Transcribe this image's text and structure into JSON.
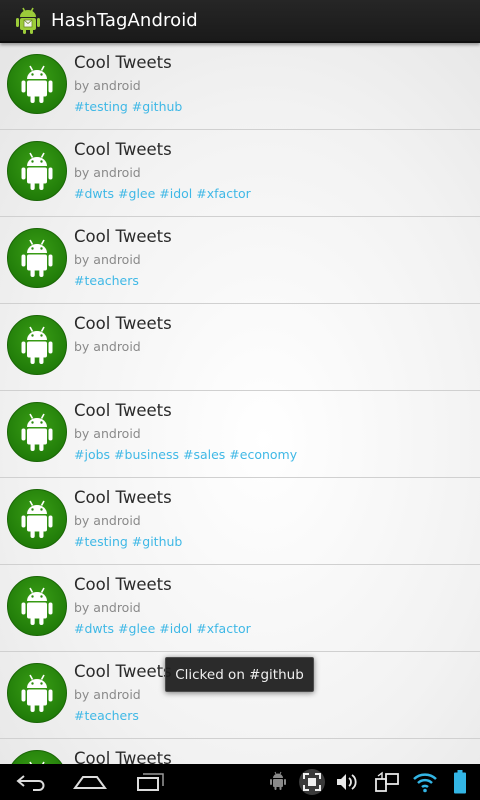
{
  "app": {
    "title": "HashTagAndroid",
    "icon": "android-app-icon"
  },
  "tweets": [
    {
      "title": "Cool Tweets",
      "author": "by android",
      "tags": [
        "#testing",
        "#github"
      ]
    },
    {
      "title": "Cool Tweets",
      "author": "by android",
      "tags": [
        "#dwts",
        "#glee",
        "#idol",
        "#xfactor"
      ]
    },
    {
      "title": "Cool Tweets",
      "author": "by android",
      "tags": [
        "#teachers"
      ]
    },
    {
      "title": "Cool Tweets",
      "author": "by android",
      "tags": []
    },
    {
      "title": "Cool Tweets",
      "author": "by android",
      "tags": [
        "#jobs",
        "#business",
        "#sales",
        "#economy"
      ]
    },
    {
      "title": "Cool Tweets",
      "author": "by android",
      "tags": [
        "#testing",
        "#github"
      ]
    },
    {
      "title": "Cool Tweets",
      "author": "by android",
      "tags": [
        "#dwts",
        "#glee",
        "#idol",
        "#xfactor"
      ]
    },
    {
      "title": "Cool Tweets",
      "author": "by android",
      "tags": [
        "#teachers"
      ]
    },
    {
      "title": "Cool Tweets",
      "author": "",
      "tags": []
    }
  ],
  "toast": {
    "message": "Clicked on #github"
  },
  "system_bar": {
    "icons": [
      "back-icon",
      "home-icon",
      "recent-apps-icon",
      "android-debug-icon",
      "screenshot-icon",
      "volume-icon",
      "screen-rotate-icon",
      "wifi-icon",
      "battery-icon"
    ]
  },
  "colors": {
    "action_bar": "#1f1f1f",
    "tag": "#3fb8e6",
    "avatar_green": "#2e8b10",
    "wifi": "#33b5e5"
  }
}
